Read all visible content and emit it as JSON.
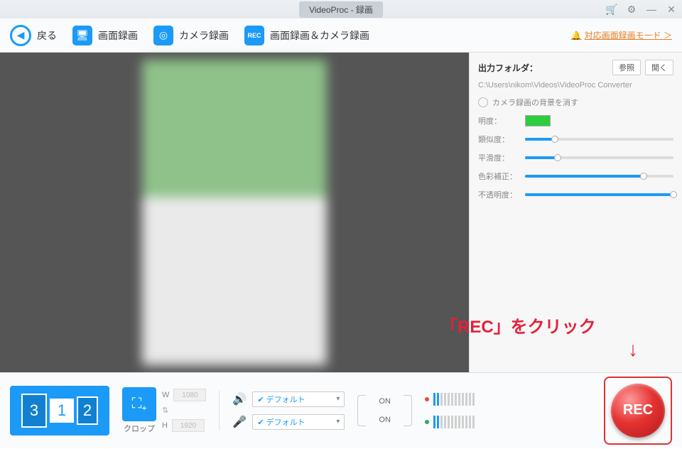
{
  "titlebar": {
    "title": "VideoProc - 録画"
  },
  "toolbar": {
    "back": "戻る",
    "screen_rec": "画面録画",
    "camera_rec": "カメラ録画",
    "screen_camera_rec": "画面録画＆カメラ録画",
    "mode_link": "対応画面録画モード ＞"
  },
  "sidebar": {
    "folder_label": "出力フォルダ：",
    "browse": "参照",
    "open": "開く",
    "path": "C:\\Users\\nikom\\Videos\\VideoProc Converter",
    "erase_bg": "カメラ録画の背景を消す",
    "brightness": "明度：",
    "similarity": "類似度：",
    "smoothness": "平滑度：",
    "color_correct": "色彩補正：",
    "opacity": "不透明度：",
    "slider_values": {
      "similarity": 20,
      "smoothness": 22,
      "color_correct": 80,
      "opacity": 100
    }
  },
  "bottom": {
    "monitors": [
      "3",
      "1",
      "2"
    ],
    "crop_label": "クロップ",
    "width_label": "W",
    "height_label": "H",
    "width_value": "1080",
    "height_value": "1920",
    "audio_default": "デフォルト",
    "on_label": "ON",
    "rec_label": "REC"
  },
  "annotation": {
    "text": "「REC」をクリック",
    "arrow": "↓"
  }
}
